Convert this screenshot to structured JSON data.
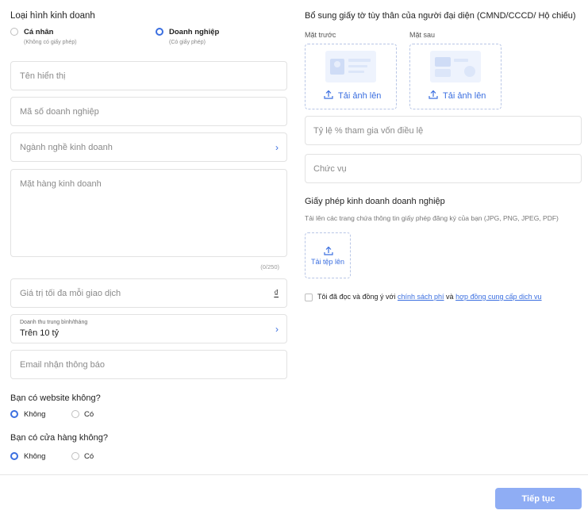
{
  "business_type": {
    "title": "Loại hình kinh doanh",
    "options": [
      {
        "label": "Cá nhân",
        "sub": "(Không có giấy phép)",
        "checked": false
      },
      {
        "label": "Doanh nghiệp",
        "sub": "(Có giấy phép)",
        "checked": true
      }
    ]
  },
  "fields": {
    "display_name": "Tên hiển thị",
    "business_code": "Mã số doanh nghiệp",
    "industry": "Ngành nghề kinh doanh",
    "products": "Mặt hàng kinh doanh",
    "products_counter": "(0/250)",
    "max_value": "Giá trị tối đa mỗi giao dịch",
    "currency": "₫",
    "revenue_label": "Doanh thu trung bình/tháng",
    "revenue_value": "Trên 10 tỷ",
    "email": "Email nhận thông báo"
  },
  "website": {
    "question": "Bạn có website không?",
    "options": [
      "Không",
      "Có"
    ],
    "selected": "Không"
  },
  "store": {
    "question": "Bạn có cửa hàng không?",
    "options": [
      "Không",
      "Có"
    ],
    "selected": "Không"
  },
  "id_docs": {
    "title": "Bổ sung giấy tờ tùy thân của người đại diện (CMND/CCCD/ Hộ chiếu)",
    "front_label": "Mặt trước",
    "back_label": "Mặt sau",
    "upload_label": "Tải ảnh lên"
  },
  "right_fields": {
    "capital_ratio": "Tỷ lệ % tham gia vốn điều lệ",
    "position": "Chức vụ"
  },
  "license": {
    "title": "Giấy phép kinh doanh doanh nghiệp",
    "note": "Tải lên các trang chứa thông tin giấy phép đăng ký của bạn (JPG, PNG, JPEG, PDF)",
    "upload_label": "Tải tệp lên"
  },
  "agreement": {
    "prefix": "Tôi đã đọc và đồng ý với",
    "link1": "chính sách phí",
    "middle": "và",
    "link2": "hợp đồng cung cấp dịch vụ"
  },
  "footer": {
    "next_label": "Tiếp tục"
  },
  "colors": {
    "accent": "#3b6fe0",
    "button": "#8fadf4"
  }
}
